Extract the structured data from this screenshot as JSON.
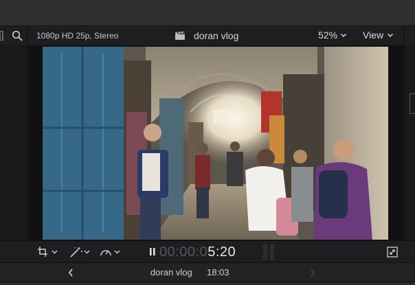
{
  "viewer": {
    "format_info": "1080p HD 25p, Stereo",
    "project_title": "doran vlog",
    "zoom_level": "52%",
    "view_menu_label": "View"
  },
  "controls": {
    "timecode_dim": "00:00:0",
    "timecode_bright": "5:20"
  },
  "timeline": {
    "title": "doran vlog",
    "duration": "18:03"
  },
  "icons": [
    "search-icon",
    "clapper-icon",
    "chevron-down-icon",
    "crop-icon",
    "magic-wand-icon",
    "speed-gauge-icon",
    "pause-icon",
    "fullscreen-icon",
    "chevron-left-icon",
    "chevron-right-icon"
  ],
  "colors": {
    "background": "#1b1b1d",
    "toolbar": "#2f2f31",
    "text": "#cfcfd1",
    "accent_dim": "#56565a"
  }
}
